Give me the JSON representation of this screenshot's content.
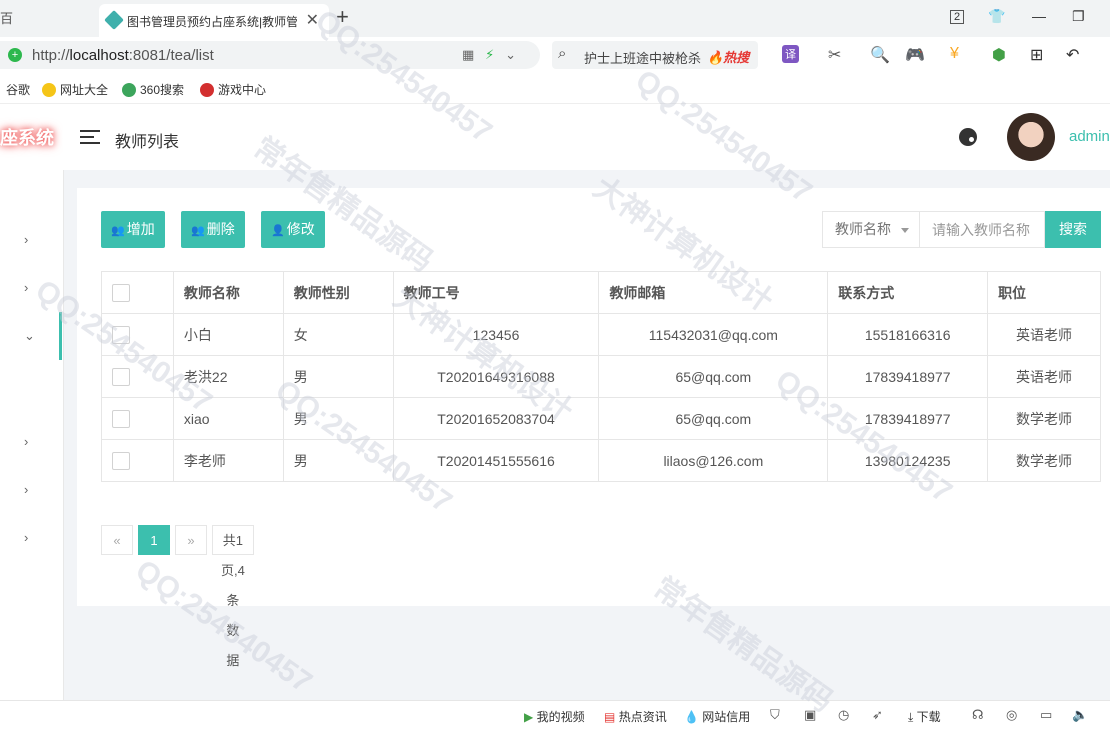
{
  "browser": {
    "tab_left_stub": "百",
    "tab_title": "图书管理员预约占座系统|教师管",
    "tab_close": "✕",
    "new_tab": "+",
    "tab_count": "2",
    "url_prefix": "http://",
    "url_host": "localhost",
    "url_rest": ":8081/tea/list",
    "search_text": "护士上班途中被枪杀",
    "search_hot": "🔥热搜",
    "bookmarks": [
      "谷歌",
      "网址大全",
      "360搜索",
      "游戏中心"
    ]
  },
  "app": {
    "logo": "座系统",
    "page_title": "教师列表",
    "admin_name": "admin",
    "toolbar": {
      "add_label": "增加",
      "delete_label": "删除",
      "edit_label": "修改"
    },
    "filter": {
      "field_label": "教师名称",
      "placeholder": "请输入教师名称",
      "search_label": "搜索"
    },
    "table": {
      "headers": [
        "教师名称",
        "教师性别",
        "教师工号",
        "教师邮箱",
        "联系方式",
        "职位"
      ],
      "rows": [
        [
          "小白",
          "女",
          "123456",
          "115432031@qq.com",
          "15518166316",
          "英语老师"
        ],
        [
          "老洪22",
          "男",
          "T20201649316088",
          "65@qq.com",
          "17839418977",
          "英语老师"
        ],
        [
          "xiao",
          "男",
          "T20201652083704",
          "65@qq.com",
          "17839418977",
          "数学老师"
        ],
        [
          "李老师",
          "男",
          "T20201451555616",
          "lilaos@126.com",
          "13980124235",
          "数学老师"
        ]
      ]
    },
    "pager": {
      "prev": "«",
      "current": "1",
      "next": "»",
      "info": "共1页,4条数据"
    }
  },
  "statusbar": {
    "items": [
      "我的视频",
      "热点资讯",
      "网站信用",
      "下载"
    ]
  },
  "watermark": {
    "texts": [
      "QQ:254540457",
      "大神计算机设计",
      "常年售精品源码"
    ]
  },
  "colors": {
    "accent": "#3cbfae",
    "hot": "#e53935"
  }
}
